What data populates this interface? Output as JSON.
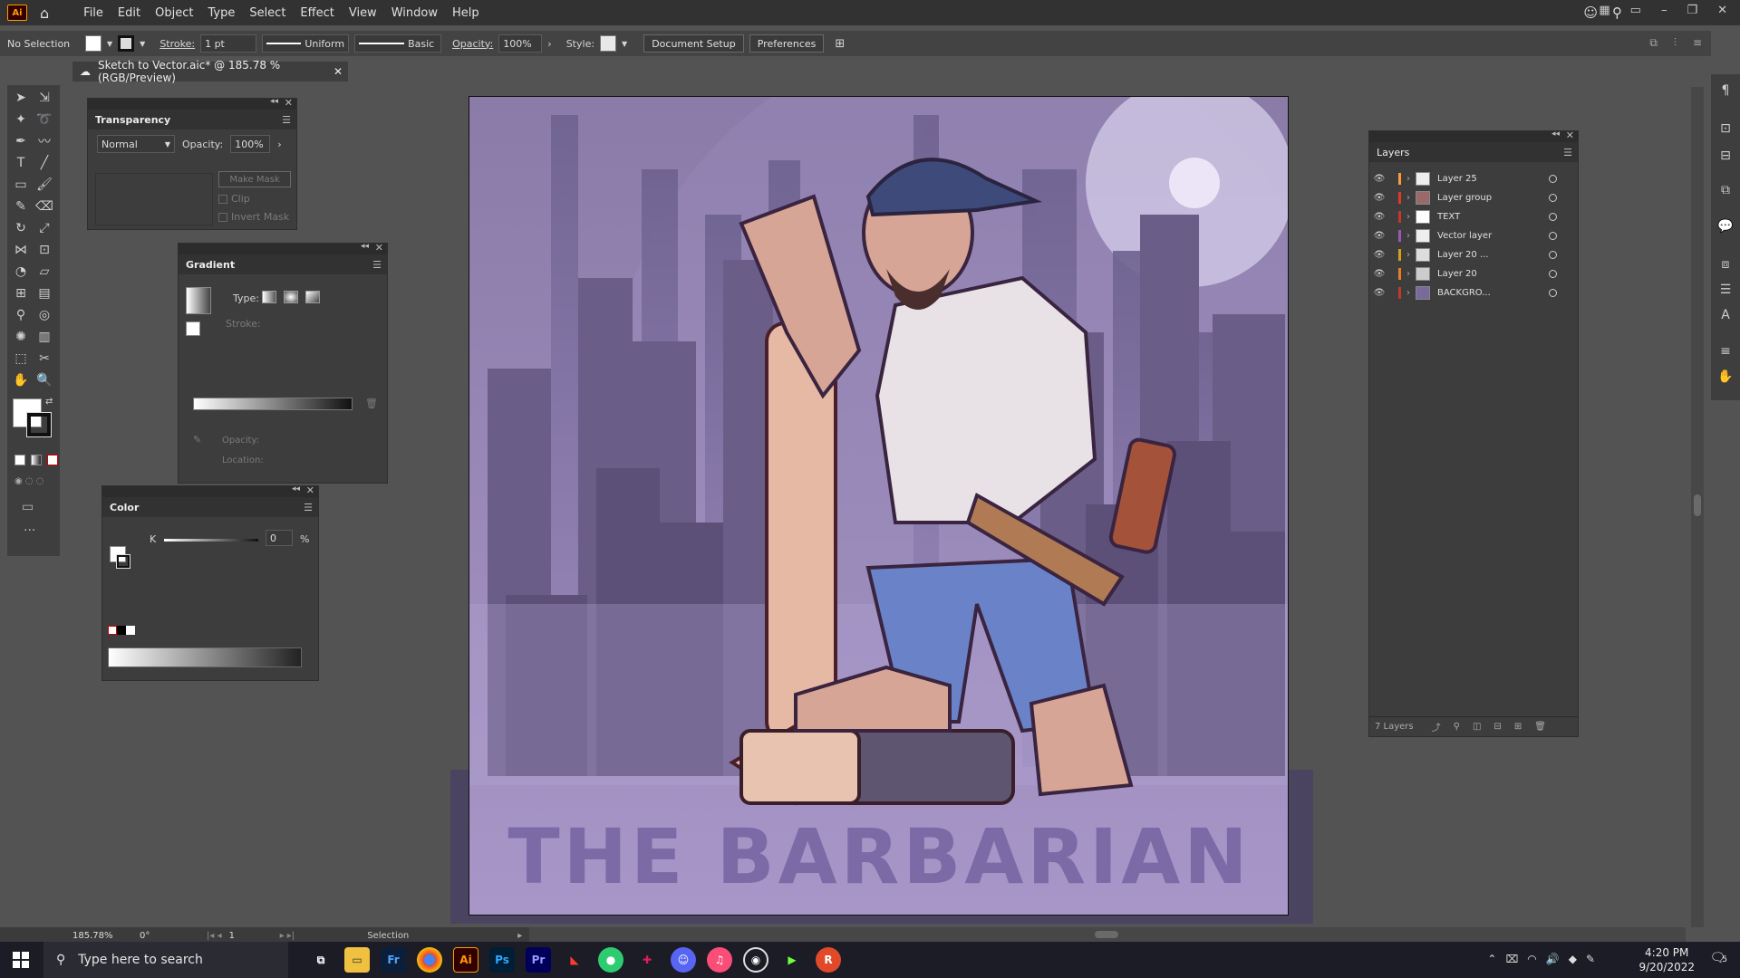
{
  "app": {
    "logo": "Ai"
  },
  "menu": [
    "File",
    "Edit",
    "Object",
    "Type",
    "Select",
    "Effect",
    "View",
    "Window",
    "Help"
  ],
  "control_bar": {
    "selection": "No Selection",
    "stroke_label": "Stroke:",
    "stroke_weight": "1 pt",
    "stroke_profile": "Uniform",
    "brush": "Basic",
    "opacity_label": "Opacity:",
    "opacity_value": "100%",
    "style_label": "Style:",
    "document_setup": "Document Setup",
    "preferences": "Preferences"
  },
  "document_tab": {
    "title": "Sketch to Vector.aic* @ 185.78 % (RGB/Preview)"
  },
  "transparency": {
    "title": "Transparency",
    "blend_mode": "Normal",
    "opacity_label": "Opacity:",
    "opacity_value": "100%",
    "make_mask": "Make Mask",
    "clip": "Clip",
    "invert_mask": "Invert Mask"
  },
  "gradient": {
    "title": "Gradient",
    "type_label": "Type:",
    "stroke_label": "Stroke:",
    "opacity_label": "Opacity:",
    "location_label": "Location:"
  },
  "color": {
    "title": "Color",
    "channel": "K",
    "value": "0",
    "unit": "%"
  },
  "layers": {
    "title": "Layers",
    "count_label": "7 Layers",
    "items": [
      {
        "name": "Layer 25",
        "color": "#ff9a3c"
      },
      {
        "name": "Layer group",
        "color": "#e0392b"
      },
      {
        "name": "TEXT",
        "color": "#c0392b"
      },
      {
        "name": "Vector layer",
        "color": "#9b59b6"
      },
      {
        "name": "Layer 20 ...",
        "color": "#d4a017"
      },
      {
        "name": "Layer 20",
        "color": "#e67e22"
      },
      {
        "name": "BACKGRO...",
        "color": "#c0392b"
      }
    ]
  },
  "artwork": {
    "title": "THE BARBARIAN"
  },
  "status": {
    "zoom": "185.78%",
    "rotation": "0°",
    "artboard": "1",
    "tool": "Selection"
  },
  "taskbar": {
    "search_placeholder": "Type here to search",
    "time": "4:20 PM",
    "date": "9/20/2022",
    "notifications": "5"
  }
}
